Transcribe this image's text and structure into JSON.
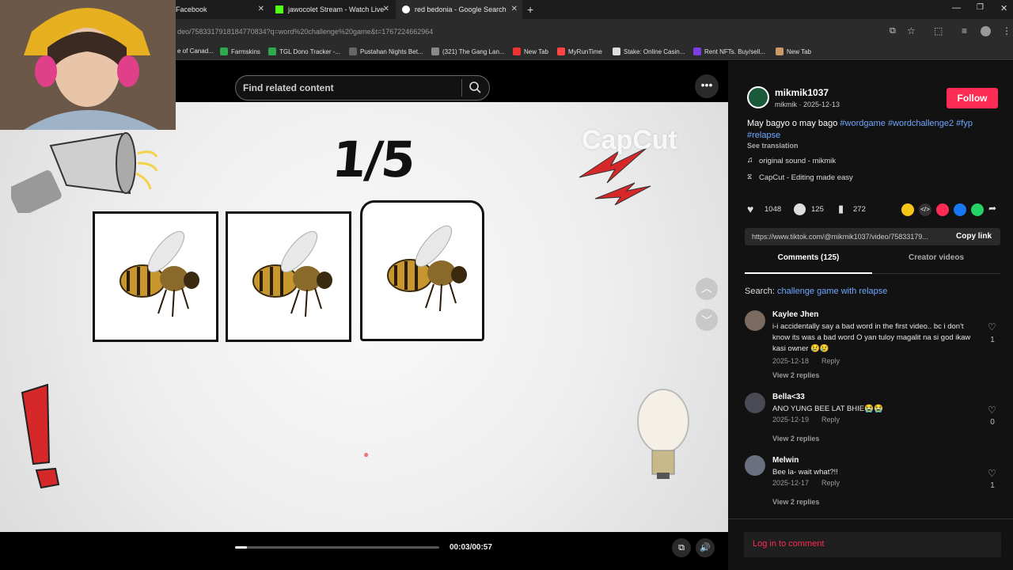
{
  "browser": {
    "tabs": [
      {
        "label": "Facebook"
      },
      {
        "label": "jawocolet Stream - Watch Live"
      },
      {
        "label": "red bedonia - Google Search"
      }
    ],
    "url": "deo/7583317918184770834?q=word%20challenge%20game&t=1767224662964",
    "bookmarks": [
      {
        "label": "e of Canad..."
      },
      {
        "label": "Farmskins"
      },
      {
        "label": "TGL Dono Tracker -..."
      },
      {
        "label": "Pustahan Nights Bet..."
      },
      {
        "label": "(321) The Gang Lan..."
      },
      {
        "label": "New Tab"
      },
      {
        "label": "MyRunTime"
      },
      {
        "label": "Stake: Online Casin..."
      },
      {
        "label": "Rent NFTs. Buy/sell..."
      },
      {
        "label": "New Tab"
      }
    ]
  },
  "search": {
    "placeholder": "Find related content"
  },
  "video": {
    "counter": "1/5",
    "watermark": "CapCut",
    "progress": 0.06,
    "time": "00:03/00:57"
  },
  "creator": {
    "username": "mikmik1037",
    "sub": "mikmik · 2025-12-13",
    "follow_label": "Follow",
    "caption_text": "May bagyo o may bago ",
    "hashtags": "#wordgame #wordchallenge2 #fyp #relapse",
    "see_translation": "See translation",
    "sound": "original sound - mikmik",
    "capcut": "CapCut - Editing made easy"
  },
  "stats": {
    "likes": "1048",
    "comments": "125",
    "saves": "272"
  },
  "link": {
    "url": "https://www.tiktok.com/@mikmik1037/video/75833179...",
    "copy_label": "Copy link"
  },
  "tabs": {
    "comments": "Comments (125)",
    "creator_videos": "Creator videos"
  },
  "search_suggest": {
    "prefix": "Search:",
    "query": "challenge game with relapse"
  },
  "comments": [
    {
      "name": "Kaylee Jhen",
      "text": "i-i accidentally say a bad word in the first video.. bc i don't know its was a bad word O yan tuloy magalit na si god ikaw kasi owner 😢😢",
      "date": "2025-12-18",
      "reply": "Reply",
      "replies": "View 2 replies",
      "likes": "1"
    },
    {
      "name": "Bella<33",
      "text": "ANO YUNG BEE LAT BHIE😭😭",
      "date": "2025-12-19",
      "reply": "Reply",
      "replies": "View 2 replies",
      "likes": "0"
    },
    {
      "name": "Melwin",
      "text": "Bee la- wait what?!!",
      "date": "2025-12-17",
      "reply": "Reply",
      "replies": "View 2 replies",
      "likes": "1"
    }
  ],
  "login": "Log in to comment",
  "colors": {
    "accent": "#fe2c55",
    "hashtag": "#6fa8ff"
  }
}
